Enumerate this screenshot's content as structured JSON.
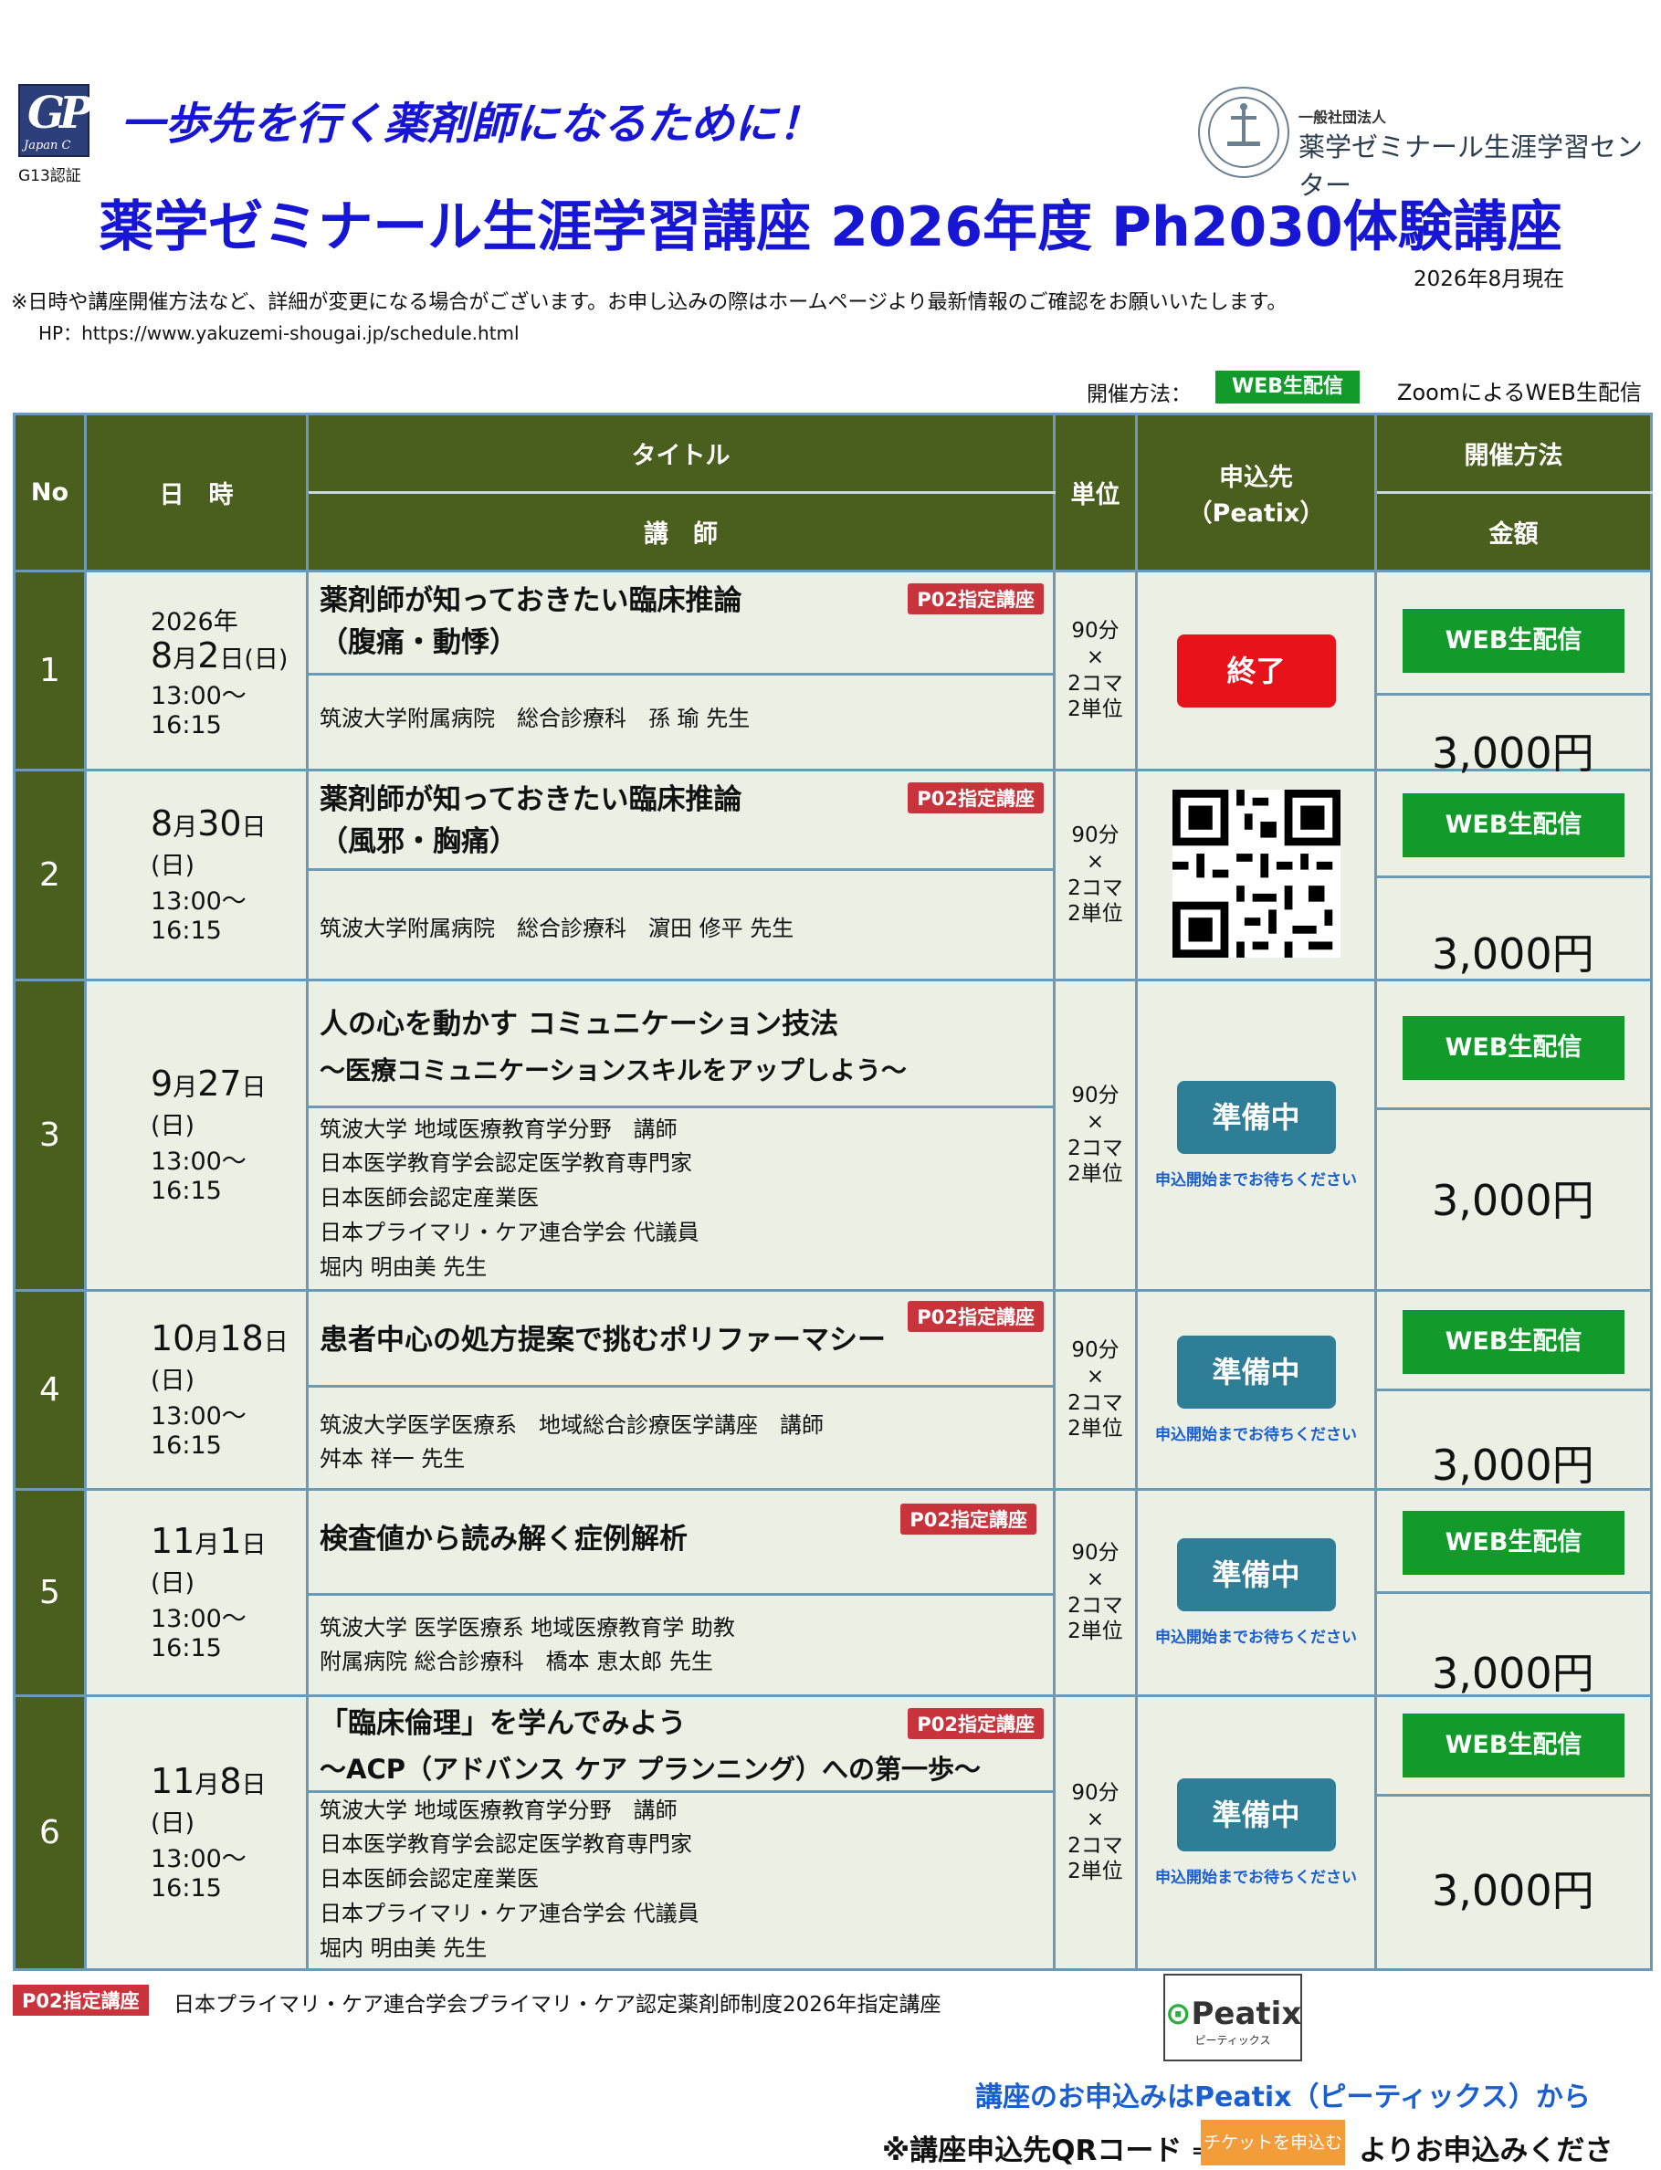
{
  "header": {
    "g13": "G13認証",
    "slogan": "一歩先を行く薬剤師になるために！",
    "center_name_small": "一般社団法人",
    "center_name": "薬学ゼミナール生涯学習センター",
    "main_title": "薬学ゼミナール生涯学習講座 2026年度 Ph2030体験講座",
    "as_of": "2026年8月現在",
    "notice": "※日時や講座開催方法など、詳細が変更になる場合がございます。お申し込みの際はホームページより最新情報のご確認をお願いいたします。",
    "hp": "HP：https://www.yakuzemi-shougai.jp/schedule.html",
    "method_label": "開催方法：",
    "method_badge": "WEB生配信",
    "method_text": "ZoomによるWEB生配信"
  },
  "table_header": {
    "no": "No",
    "date": "日　時",
    "title": "タイトル",
    "lecturer": "講　師",
    "unit": "単位",
    "apply_line1": "申込先",
    "apply_line2": "（Peatix）",
    "method": "開催方法",
    "price": "金額"
  },
  "common": {
    "time": "13:00～16:15",
    "unit_l1": "90分",
    "unit_l2": "×",
    "unit_l3": "2コマ",
    "unit_l4": "2単位",
    "p02": "P02指定講座",
    "web": "WEB生配信",
    "price": "3,000円",
    "ended": "終了",
    "prep": "準備中",
    "prep_note": "申込開始までお待ちください",
    "year": "2026年",
    "weekday": "(日)"
  },
  "rows": [
    {
      "no": "1",
      "month": "8",
      "day": "2",
      "title1": "薬剤師が知っておきたい臨床推論",
      "title2": "（腹痛・動悸）",
      "lec": [
        "筑波大学附属病院　総合診療科　孫 瑜 先生"
      ]
    },
    {
      "no": "2",
      "month": "8",
      "day": "30",
      "title1": "薬剤師が知っておきたい臨床推論",
      "title2": "（風邪・胸痛）",
      "lec": [
        "筑波大学附属病院　総合診療科　濵田 修平 先生"
      ]
    },
    {
      "no": "3",
      "month": "9",
      "day": "27",
      "title1": "人の心を動かす コミュニケーション技法",
      "title2": "～医療コミュニケーションスキルをアップしよう～",
      "lec": [
        "筑波大学 地域医療教育学分野　講師",
        "日本医学教育学会認定医学教育専門家",
        "日本医師会認定産業医",
        "日本プライマリ・ケア連合学会 代議員",
        "堀内 明由美 先生"
      ]
    },
    {
      "no": "4",
      "month": "10",
      "day": "18",
      "title1": "患者中心の処方提案で挑むポリファーマシー",
      "title2": "",
      "lec": [
        "筑波大学医学医療系　地域総合診療医学講座　講師",
        "舛本 祥一 先生"
      ]
    },
    {
      "no": "5",
      "month": "11",
      "day": "1",
      "title1": "検査値から読み解く症例解析",
      "title2": "",
      "lec": [
        "筑波大学 医学医療系 地域医療教育学 助教",
        "附属病院 総合診療科　橋本 恵太郎 先生"
      ]
    },
    {
      "no": "6",
      "month": "11",
      "day": "8",
      "title1": "「臨床倫理」を学んでみよう",
      "title2": "～ACP（アドバンス ケア プランニング）への第一歩～",
      "lec": [
        "筑波大学 地域医療教育学分野　講師",
        "日本医学教育学会認定医学教育専門家",
        "日本医師会認定産業医",
        "日本プライマリ・ケア連合学会 代議員",
        "堀内 明由美 先生"
      ]
    }
  ],
  "footer": {
    "p02": "P02指定講座",
    "p02_text": "日本プライマリ・ケア連合学会プライマリ・ケア認定薬剤師制度2026年指定講座",
    "peatix_logo": "Peatix",
    "peatix_sub": "ピーティックス",
    "apply_note": "講座のお申込みはPeatix（ピーティックス）から",
    "qr_note": "※講座申込先QRコード ⇒",
    "ticket_btn": "チケットを申込む",
    "qr_note2": "よりお申込みください。"
  },
  "colors": {
    "header_green": "#4a5e1e",
    "web_green": "#129a2b",
    "ended_red": "#e8121b",
    "prep_blue": "#2e7e97",
    "p02_red": "#c9333c",
    "title_blue": "#1616d4"
  }
}
